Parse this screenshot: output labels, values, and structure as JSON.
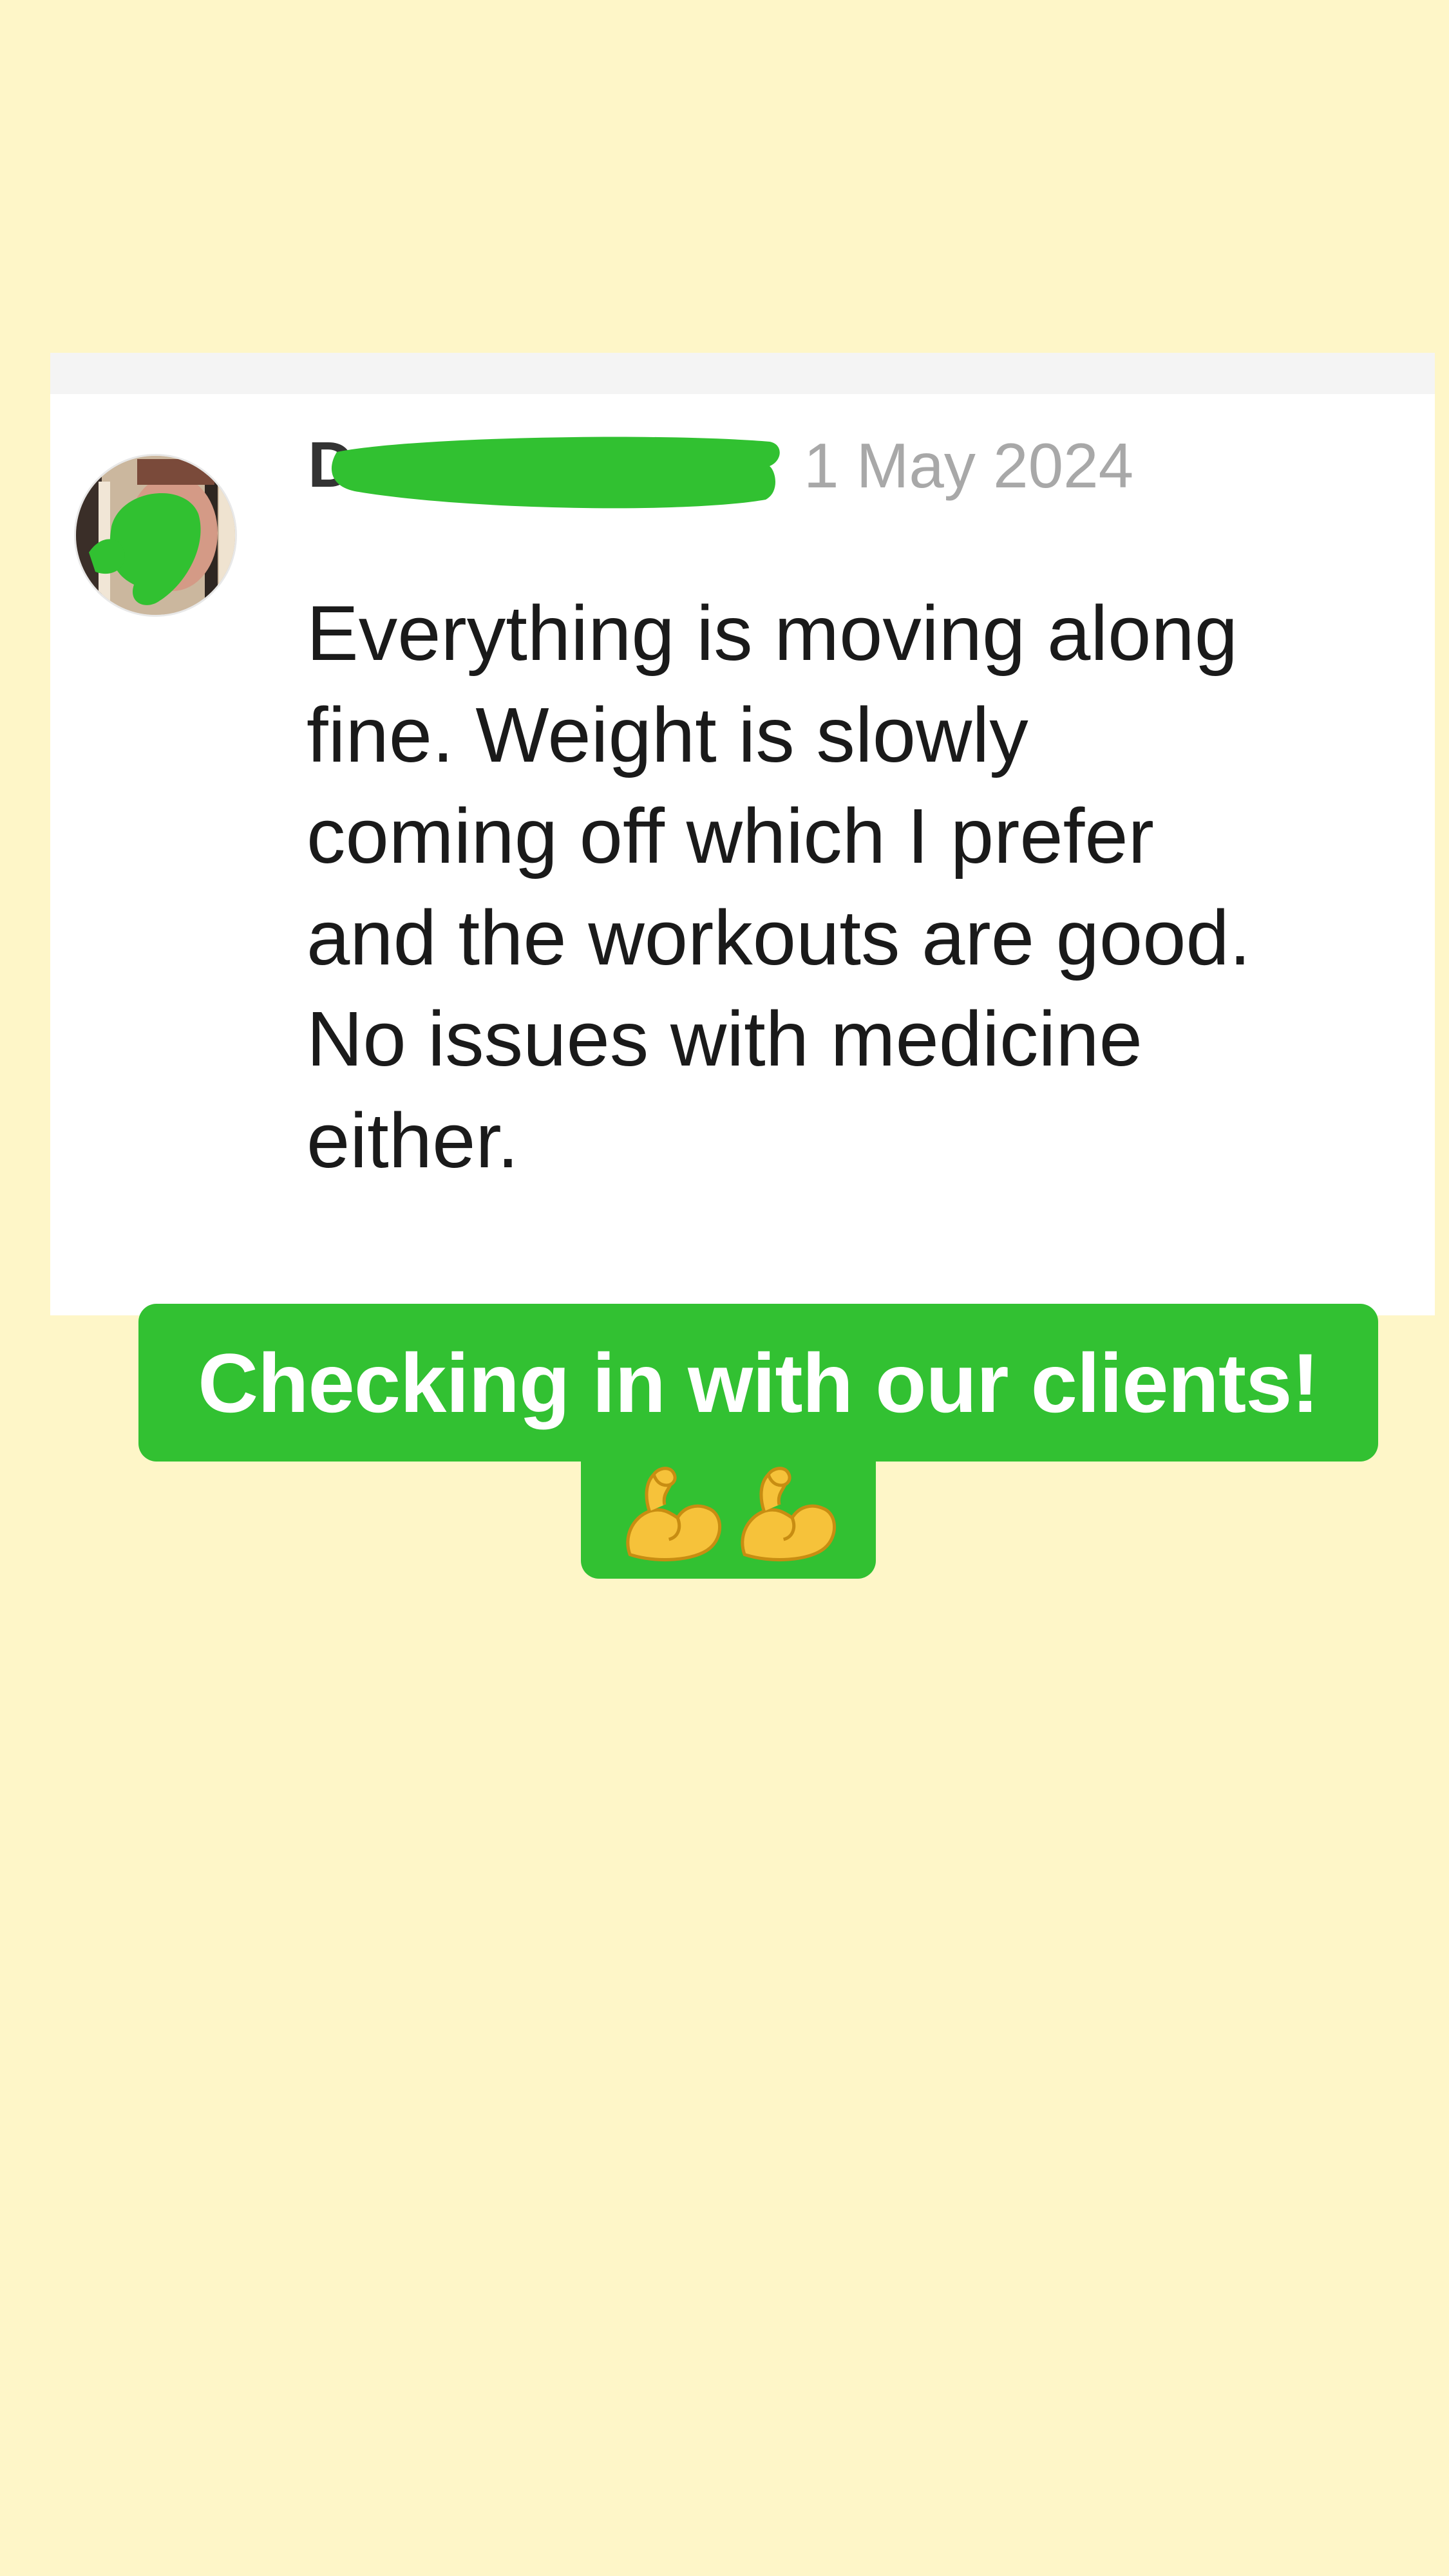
{
  "comment": {
    "author_initials": "Da",
    "date": "1 May 2024",
    "body_lines": [
      "Everything is moving along",
      "fine. Weight is slowly",
      "coming off which I prefer",
      "and the workouts are good.",
      "No issues with medicine",
      "either."
    ]
  },
  "caption": {
    "text": "Checking in with our clients!",
    "emoji_icons": [
      "flexed-biceps-icon",
      "flexed-biceps-icon"
    ]
  },
  "colors": {
    "background": "#fef6c8",
    "caption_green": "#32c132",
    "redaction_green": "#31c131",
    "date_gray": "#a8a8a8"
  }
}
